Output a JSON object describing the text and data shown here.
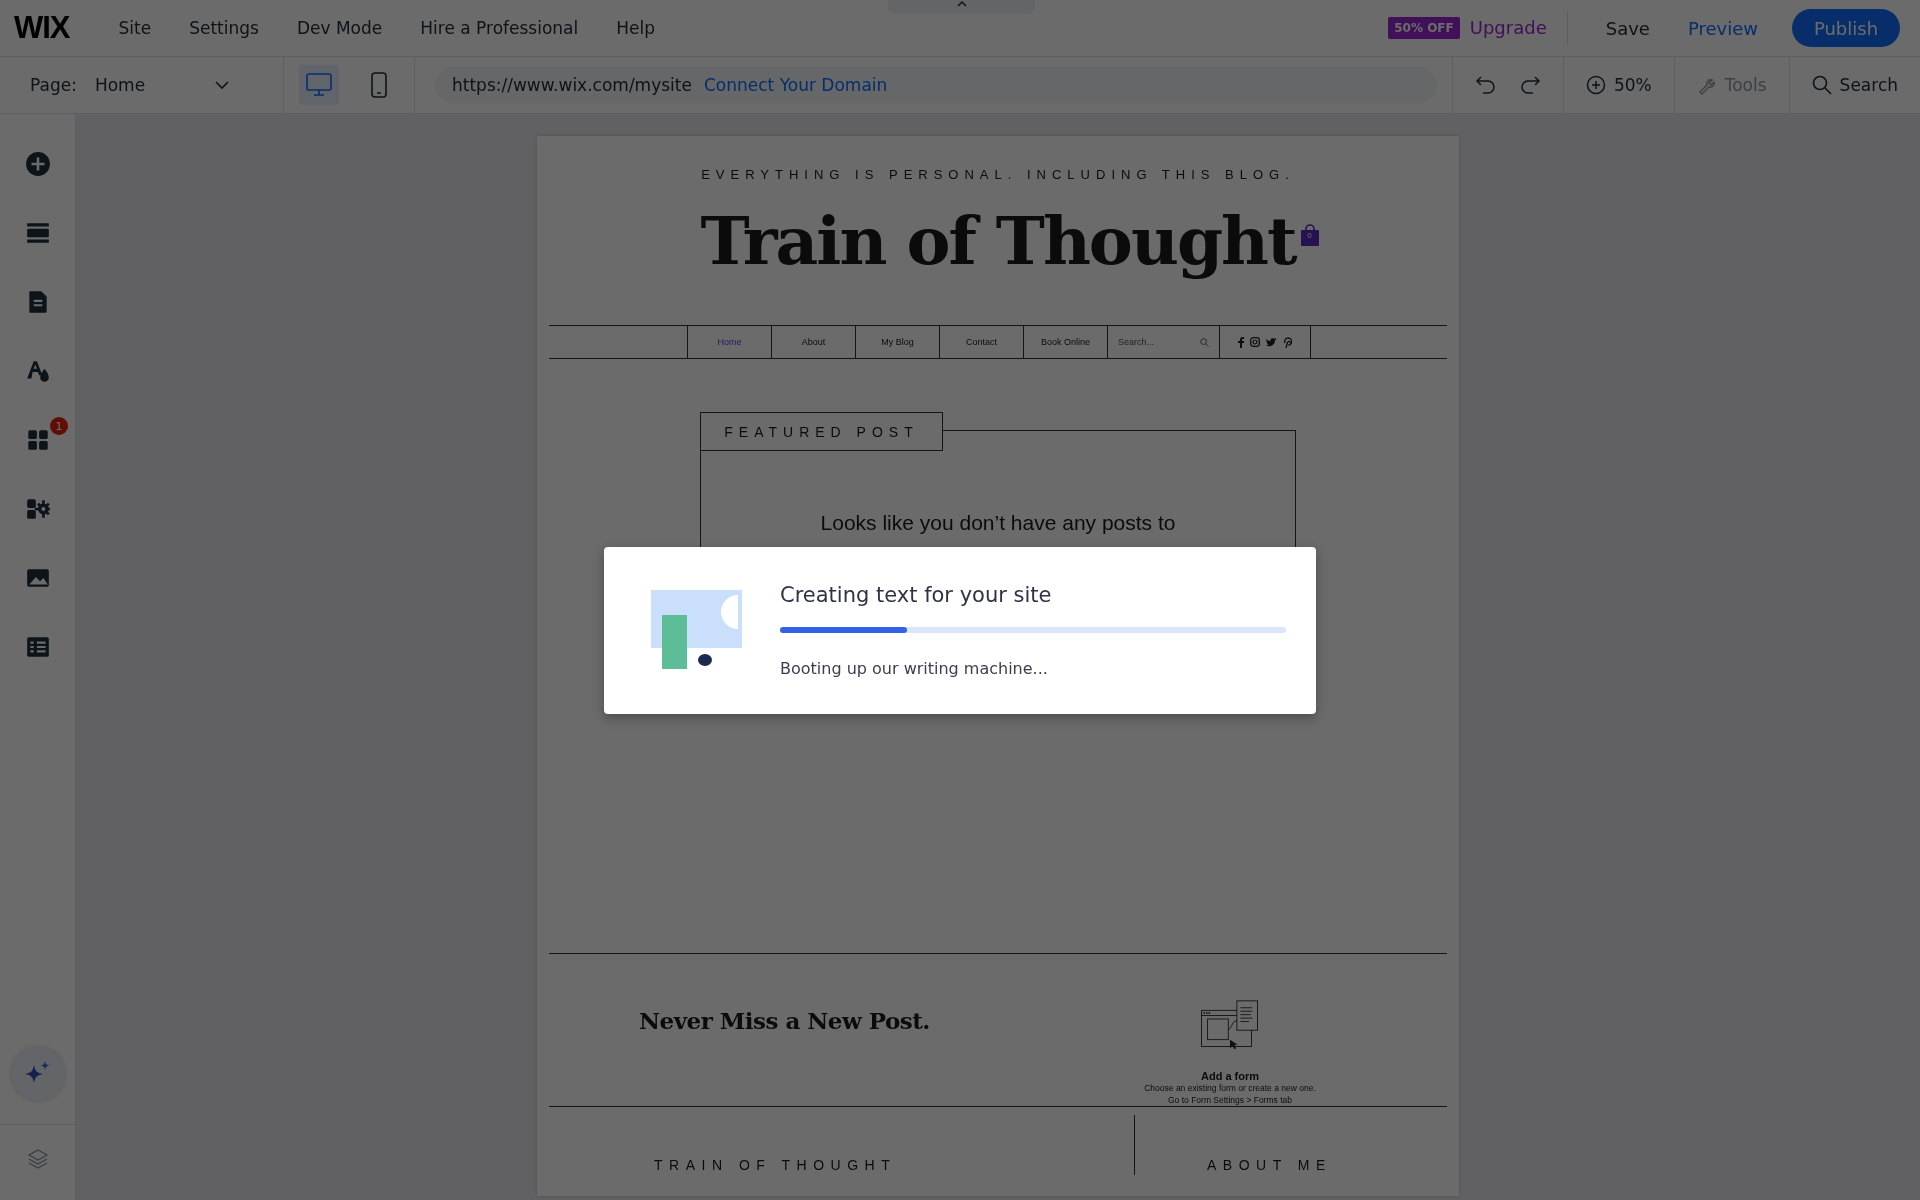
{
  "menu_bar": {
    "logo": "WIX",
    "items": [
      "Site",
      "Settings",
      "Dev Mode",
      "Hire a Professional",
      "Help"
    ],
    "sale_badge": "50% OFF",
    "upgrade": "Upgrade",
    "save": "Save",
    "preview": "Preview",
    "publish": "Publish"
  },
  "toolbar": {
    "page_label": "Page:",
    "page": "Home",
    "views": [
      {
        "kind": "desktop",
        "selected": true
      },
      {
        "kind": "mobile",
        "selected": false
      }
    ],
    "url": "https://www.wix.com/mysite",
    "connect_domain": "Connect Your Domain",
    "zoom": "50%",
    "tools": {
      "label": "Tools",
      "disabled": true
    },
    "search": "Search"
  },
  "sidebar": {
    "items": [
      {
        "kind": "add"
      },
      {
        "kind": "sections"
      },
      {
        "kind": "pages"
      },
      {
        "kind": "design"
      },
      {
        "kind": "apps",
        "badge": "1"
      },
      {
        "kind": "business"
      },
      {
        "kind": "media"
      },
      {
        "kind": "table"
      }
    ]
  },
  "site": {
    "tagline": "EVERYTHING IS PERSONAL. INCLUDING THIS BLOG.",
    "title": "Train of Thought",
    "cart_count": "0",
    "nav": [
      {
        "label": "Home",
        "selected": true
      },
      {
        "label": "About",
        "selected": false
      },
      {
        "label": "My Blog",
        "selected": false
      },
      {
        "label": "Contact",
        "selected": false
      },
      {
        "label": "Book Online",
        "selected": false
      }
    ],
    "nav_search": {
      "placeholder": "Search..."
    },
    "featured_label": "FEATURED POST",
    "empty_message": "Looks like you don’t have any posts to",
    "subscribe_heading": "Never Miss a New Post.",
    "form_placeholder": {
      "title": "Add a form",
      "lines": [
        "Choose an existing form or create a new one.",
        "Go to Form Settings > Forms tab"
      ]
    },
    "footer_columns": [
      "TRAIN OF THOUGHT",
      "ABOUT ME"
    ]
  },
  "dialog": {
    "title": "Creating text for your site",
    "level": 0.25,
    "message": "Booting up our writing machine..."
  }
}
